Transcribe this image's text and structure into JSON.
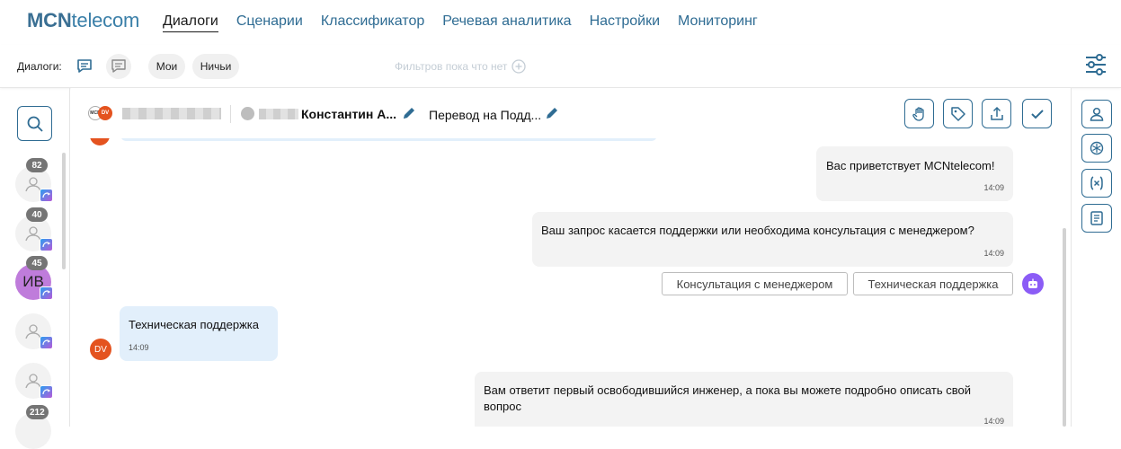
{
  "app": {
    "logo_bold": "MCN",
    "logo_light": "telecom"
  },
  "nav": {
    "items": [
      "Диалоги",
      "Сценарии",
      "Классификатор",
      "Речевая аналитика",
      "Настройки",
      "Мониторинг"
    ],
    "active": "Диалоги"
  },
  "filterbar": {
    "label": "Диалоги:",
    "mine": "Мои",
    "nobody": "Ничьи",
    "no_filters": "Фильтров пока что нет"
  },
  "dialogs": [
    {
      "badge": "82",
      "initials": ""
    },
    {
      "badge": "40",
      "initials": ""
    },
    {
      "badge": "45",
      "initials": "ИВ"
    },
    {
      "badge": "",
      "initials": ""
    },
    {
      "badge": "",
      "initials": ""
    },
    {
      "badge": "212",
      "initials": ""
    }
  ],
  "chat_header": {
    "operator_logo": "MCN",
    "client_initials": "DV",
    "contact_name": "Константин А...",
    "route": "Перевод на Подд..."
  },
  "messages": [
    {
      "role": "bot",
      "text": "Вас приветствует MCNtelecom!",
      "time": "14:09"
    },
    {
      "role": "bot",
      "text": "Ваш запрос касается поддержки или необходима консультация с менеджером?",
      "time": "14:09"
    },
    {
      "role": "user",
      "text": "Техническая поддержка",
      "time": "14:09",
      "avatar": "DV"
    },
    {
      "role": "bot",
      "text": "Вам ответит первый освободившийся инженер, а пока вы можете подробно описать свой вопрос",
      "time": "14:09"
    }
  ],
  "quick_replies": [
    "Консультация с менеджером",
    "Техническая поддержка"
  ],
  "colors": {
    "accent": "#2f6c93",
    "bot_bubble": "#f3f3f3",
    "user_bubble": "#e2effb",
    "client_avatar": "#e4531f",
    "bot_icon": "#8b5cf6",
    "dialog_avatar_purple": "#bf7cdb"
  }
}
